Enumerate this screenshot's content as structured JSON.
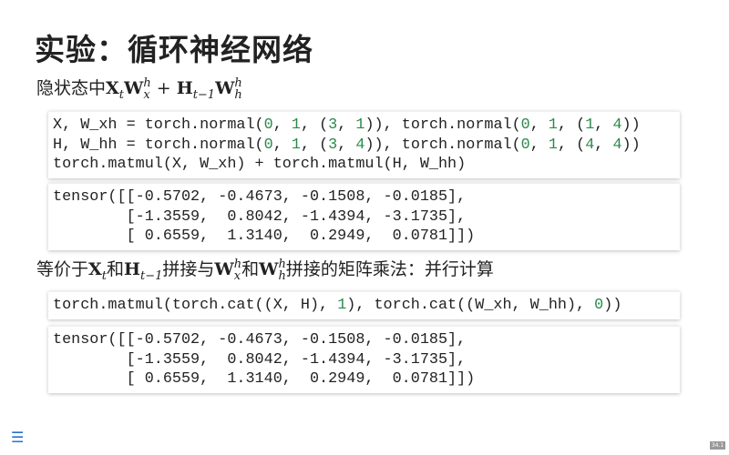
{
  "title": "实验：循环神经网络",
  "subtitle1": {
    "text": "隐状态中",
    "math": [
      "X",
      "t",
      "W",
      "x",
      "h",
      "+",
      "H",
      "t−1",
      "W",
      "h",
      "h"
    ]
  },
  "subtitle2": {
    "t1": "等价于",
    "t2": "和",
    "t3": "拼接与",
    "t4": "和",
    "t5": "拼接的矩阵乘法：并行计算",
    "math": [
      "X",
      "t",
      "H",
      "t−1",
      "W",
      "x",
      "h",
      "W",
      "h",
      "h"
    ]
  },
  "blocks": [
    {
      "kind": "code",
      "lines": [
        "X, W_xh = torch.normal(0, 1, (3, 1)), torch.normal(0, 1, (1, 4))",
        "H, W_hh = torch.normal(0, 1, (3, 4)), torch.normal(0, 1, (4, 4))",
        "torch.matmul(X, W_xh) + torch.matmul(H, W_hh)"
      ]
    },
    {
      "kind": "output",
      "lines": [
        "tensor([[-0.5702, -0.4673, -0.1508, -0.0185],",
        "        [-1.3559,  0.8042, -1.4394, -3.1735],",
        "        [ 0.6559,  1.3140,  0.2949,  0.0781]])"
      ]
    },
    {
      "kind": "code",
      "lines": [
        "torch.matmul(torch.cat((X, H), 1), torch.cat((W_xh, W_hh), 0))"
      ]
    },
    {
      "kind": "output",
      "lines": [
        "tensor([[-0.5702, -0.4673, -0.1508, -0.0185],",
        "        [-1.3559,  0.8042, -1.4394, -3.1735],",
        "        [ 0.6559,  1.3140,  0.2949,  0.0781]])"
      ]
    }
  ],
  "menu_icon": "hamburger-menu-icon",
  "page_number": "34.1",
  "colors": {
    "number": "#2a8a4a",
    "menu": "#2a6fcf"
  }
}
